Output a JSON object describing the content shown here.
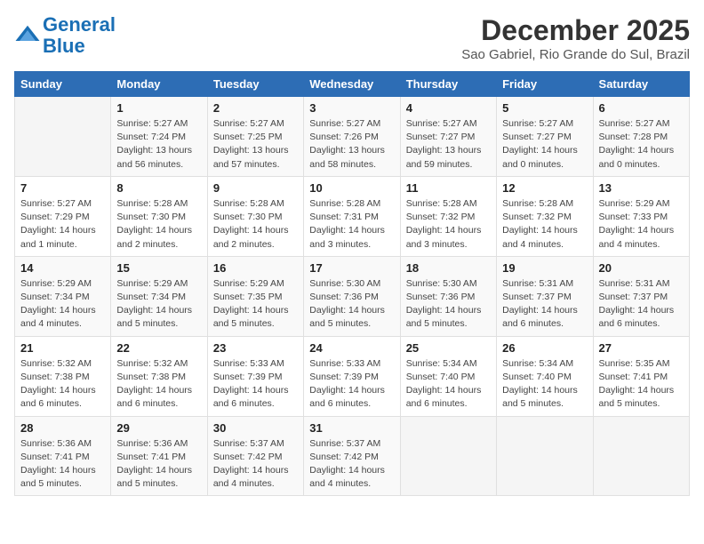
{
  "header": {
    "logo_line1": "General",
    "logo_line2": "Blue",
    "title": "December 2025",
    "subtitle": "Sao Gabriel, Rio Grande do Sul, Brazil"
  },
  "weekdays": [
    "Sunday",
    "Monday",
    "Tuesday",
    "Wednesday",
    "Thursday",
    "Friday",
    "Saturday"
  ],
  "weeks": [
    [
      {
        "num": "",
        "info": ""
      },
      {
        "num": "1",
        "info": "Sunrise: 5:27 AM\nSunset: 7:24 PM\nDaylight: 13 hours\nand 56 minutes."
      },
      {
        "num": "2",
        "info": "Sunrise: 5:27 AM\nSunset: 7:25 PM\nDaylight: 13 hours\nand 57 minutes."
      },
      {
        "num": "3",
        "info": "Sunrise: 5:27 AM\nSunset: 7:26 PM\nDaylight: 13 hours\nand 58 minutes."
      },
      {
        "num": "4",
        "info": "Sunrise: 5:27 AM\nSunset: 7:27 PM\nDaylight: 13 hours\nand 59 minutes."
      },
      {
        "num": "5",
        "info": "Sunrise: 5:27 AM\nSunset: 7:27 PM\nDaylight: 14 hours\nand 0 minutes."
      },
      {
        "num": "6",
        "info": "Sunrise: 5:27 AM\nSunset: 7:28 PM\nDaylight: 14 hours\nand 0 minutes."
      }
    ],
    [
      {
        "num": "7",
        "info": "Sunrise: 5:27 AM\nSunset: 7:29 PM\nDaylight: 14 hours\nand 1 minute."
      },
      {
        "num": "8",
        "info": "Sunrise: 5:28 AM\nSunset: 7:30 PM\nDaylight: 14 hours\nand 2 minutes."
      },
      {
        "num": "9",
        "info": "Sunrise: 5:28 AM\nSunset: 7:30 PM\nDaylight: 14 hours\nand 2 minutes."
      },
      {
        "num": "10",
        "info": "Sunrise: 5:28 AM\nSunset: 7:31 PM\nDaylight: 14 hours\nand 3 minutes."
      },
      {
        "num": "11",
        "info": "Sunrise: 5:28 AM\nSunset: 7:32 PM\nDaylight: 14 hours\nand 3 minutes."
      },
      {
        "num": "12",
        "info": "Sunrise: 5:28 AM\nSunset: 7:32 PM\nDaylight: 14 hours\nand 4 minutes."
      },
      {
        "num": "13",
        "info": "Sunrise: 5:29 AM\nSunset: 7:33 PM\nDaylight: 14 hours\nand 4 minutes."
      }
    ],
    [
      {
        "num": "14",
        "info": "Sunrise: 5:29 AM\nSunset: 7:34 PM\nDaylight: 14 hours\nand 4 minutes."
      },
      {
        "num": "15",
        "info": "Sunrise: 5:29 AM\nSunset: 7:34 PM\nDaylight: 14 hours\nand 5 minutes."
      },
      {
        "num": "16",
        "info": "Sunrise: 5:29 AM\nSunset: 7:35 PM\nDaylight: 14 hours\nand 5 minutes."
      },
      {
        "num": "17",
        "info": "Sunrise: 5:30 AM\nSunset: 7:36 PM\nDaylight: 14 hours\nand 5 minutes."
      },
      {
        "num": "18",
        "info": "Sunrise: 5:30 AM\nSunset: 7:36 PM\nDaylight: 14 hours\nand 5 minutes."
      },
      {
        "num": "19",
        "info": "Sunrise: 5:31 AM\nSunset: 7:37 PM\nDaylight: 14 hours\nand 6 minutes."
      },
      {
        "num": "20",
        "info": "Sunrise: 5:31 AM\nSunset: 7:37 PM\nDaylight: 14 hours\nand 6 minutes."
      }
    ],
    [
      {
        "num": "21",
        "info": "Sunrise: 5:32 AM\nSunset: 7:38 PM\nDaylight: 14 hours\nand 6 minutes."
      },
      {
        "num": "22",
        "info": "Sunrise: 5:32 AM\nSunset: 7:38 PM\nDaylight: 14 hours\nand 6 minutes."
      },
      {
        "num": "23",
        "info": "Sunrise: 5:33 AM\nSunset: 7:39 PM\nDaylight: 14 hours\nand 6 minutes."
      },
      {
        "num": "24",
        "info": "Sunrise: 5:33 AM\nSunset: 7:39 PM\nDaylight: 14 hours\nand 6 minutes."
      },
      {
        "num": "25",
        "info": "Sunrise: 5:34 AM\nSunset: 7:40 PM\nDaylight: 14 hours\nand 6 minutes."
      },
      {
        "num": "26",
        "info": "Sunrise: 5:34 AM\nSunset: 7:40 PM\nDaylight: 14 hours\nand 5 minutes."
      },
      {
        "num": "27",
        "info": "Sunrise: 5:35 AM\nSunset: 7:41 PM\nDaylight: 14 hours\nand 5 minutes."
      }
    ],
    [
      {
        "num": "28",
        "info": "Sunrise: 5:36 AM\nSunset: 7:41 PM\nDaylight: 14 hours\nand 5 minutes."
      },
      {
        "num": "29",
        "info": "Sunrise: 5:36 AM\nSunset: 7:41 PM\nDaylight: 14 hours\nand 5 minutes."
      },
      {
        "num": "30",
        "info": "Sunrise: 5:37 AM\nSunset: 7:42 PM\nDaylight: 14 hours\nand 4 minutes."
      },
      {
        "num": "31",
        "info": "Sunrise: 5:37 AM\nSunset: 7:42 PM\nDaylight: 14 hours\nand 4 minutes."
      },
      {
        "num": "",
        "info": ""
      },
      {
        "num": "",
        "info": ""
      },
      {
        "num": "",
        "info": ""
      }
    ]
  ]
}
